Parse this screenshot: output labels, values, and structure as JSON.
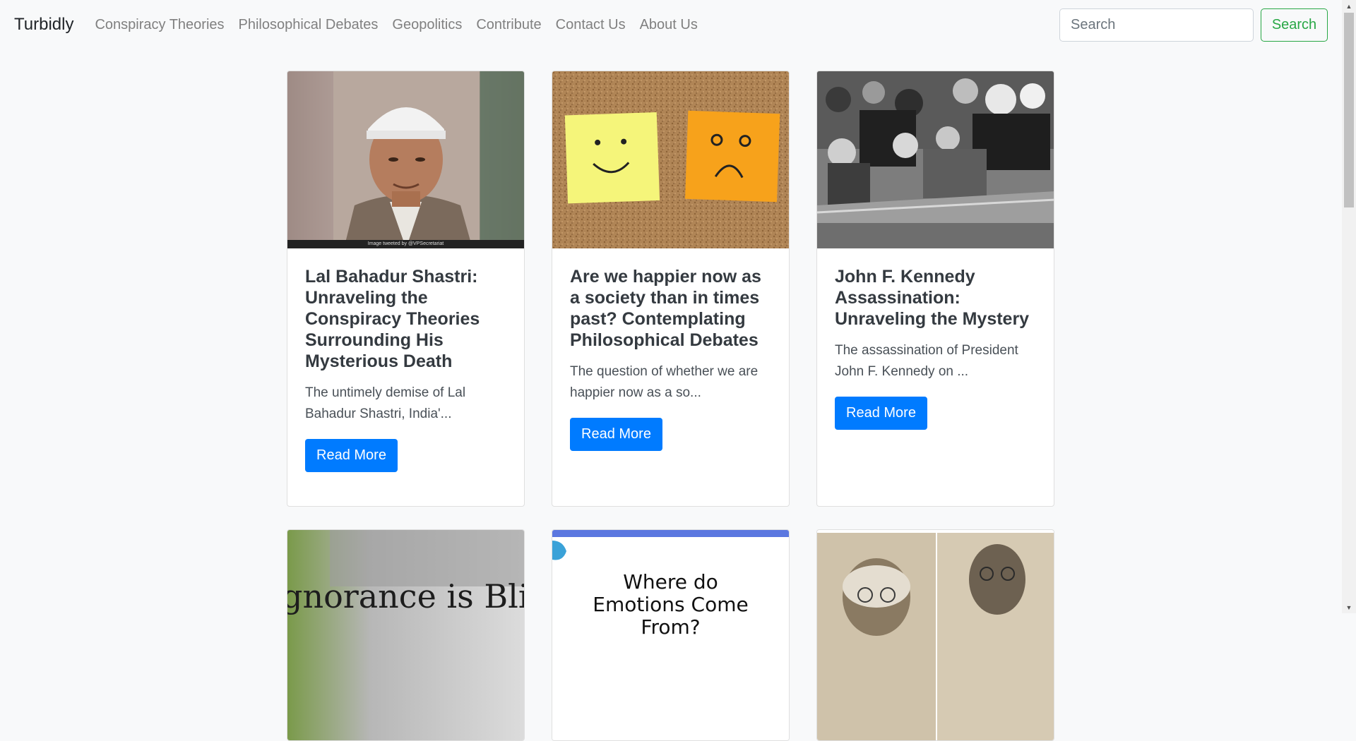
{
  "navbar": {
    "brand": "Turbidly",
    "links": [
      {
        "label": "Conspiracy Theories"
      },
      {
        "label": "Philosophical Debates"
      },
      {
        "label": "Geopolitics"
      },
      {
        "label": "Contribute"
      },
      {
        "label": "Contact Us"
      },
      {
        "label": "About Us"
      }
    ],
    "search": {
      "placeholder": "Search",
      "button_label": "Search"
    }
  },
  "cards": [
    {
      "title": "Lal Bahadur Shastri: Unraveling the Conspiracy Theories Surrounding His Mysterious Death",
      "excerpt": "The untimely demise of Lal Bahadur Shastri, India'...",
      "button_label": "Read More",
      "image_caption": "Image tweeted by @VPSecretariat"
    },
    {
      "title": "Are we happier now as a society than in times past? Contemplating Philosophical Debates",
      "excerpt": "The question of whether we are happier now as a so...",
      "button_label": "Read More"
    },
    {
      "title": "John F. Kennedy Assassination: Unraveling the Mystery",
      "excerpt": "The assassination of President John F. Kennedy on ...",
      "button_label": "Read More"
    },
    {
      "image_text": "gnorance is Blis"
    },
    {
      "image_text": "Where do Emotions Come From?"
    },
    {
      "image_text": ""
    }
  ],
  "colors": {
    "primary": "#007bff",
    "success": "#28a745",
    "background": "#f8f9fa"
  }
}
